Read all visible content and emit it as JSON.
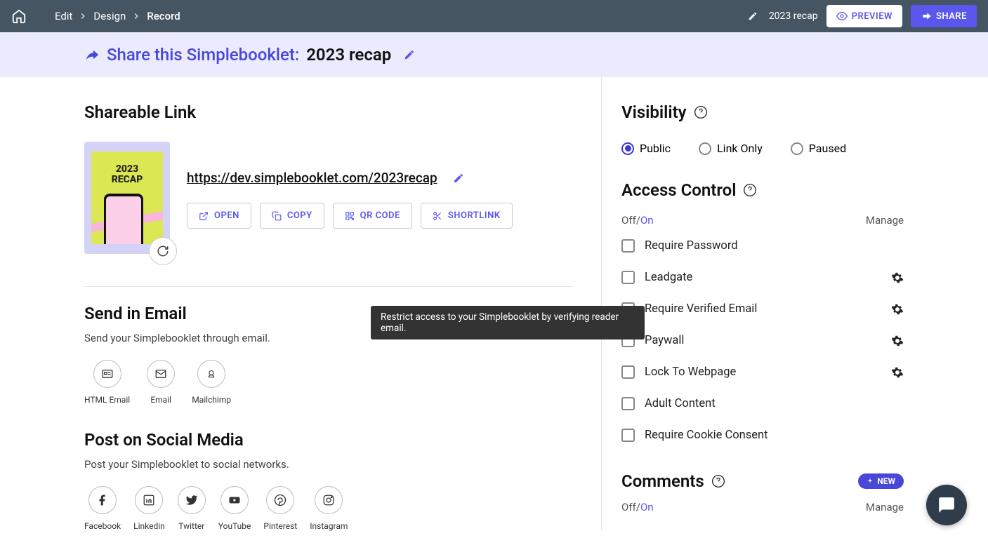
{
  "topnav": {
    "breadcrumbs": [
      "Edit",
      "Design",
      "Record"
    ],
    "title": "2023 recap",
    "preview_label": "PREVIEW",
    "share_label": "SHARE"
  },
  "subheader": {
    "label": "Share this Simplebooklet:",
    "title": "2023 recap"
  },
  "shareable": {
    "heading": "Shareable Link",
    "thumb_text": "2023\nRECAP",
    "url": "https://dev.simplebooklet.com/2023recap",
    "buttons": {
      "open": "OPEN",
      "copy": "COPY",
      "qr": "QR CODE",
      "short": "SHORTLINK"
    }
  },
  "email": {
    "heading": "Send in Email",
    "desc": "Send your Simplebooklet through email.",
    "items": [
      {
        "label": "HTML Email"
      },
      {
        "label": "Email"
      },
      {
        "label": "Mailchimp"
      }
    ]
  },
  "social": {
    "heading": "Post on Social Media",
    "desc": "Post your Simplebooklet to social networks.",
    "items": [
      {
        "label": "Facebook"
      },
      {
        "label": "Linkedin"
      },
      {
        "label": "Twitter"
      },
      {
        "label": "YouTube"
      },
      {
        "label": "Pinterest"
      },
      {
        "label": "Instagram"
      }
    ]
  },
  "visibility": {
    "heading": "Visibility",
    "options": [
      "Public",
      "Link Only",
      "Paused"
    ]
  },
  "access": {
    "heading": "Access Control",
    "off": "Off",
    "on": "On",
    "manage": "Manage",
    "items": [
      {
        "label": "Require Password",
        "gear": false
      },
      {
        "label": "Leadgate",
        "gear": true
      },
      {
        "label": "Require Verified Email",
        "gear": true
      },
      {
        "label": "Paywall",
        "gear": true
      },
      {
        "label": "Lock To Webpage",
        "gear": true
      },
      {
        "label": "Adult Content",
        "gear": false
      },
      {
        "label": "Require Cookie Consent",
        "gear": false
      }
    ]
  },
  "comments": {
    "heading": "Comments",
    "new_badge": "NEW",
    "off": "Off",
    "on": "On",
    "manage": "Manage"
  },
  "tooltip": {
    "text": "Restrict access to your Simplebooklet by verifying reader email."
  }
}
